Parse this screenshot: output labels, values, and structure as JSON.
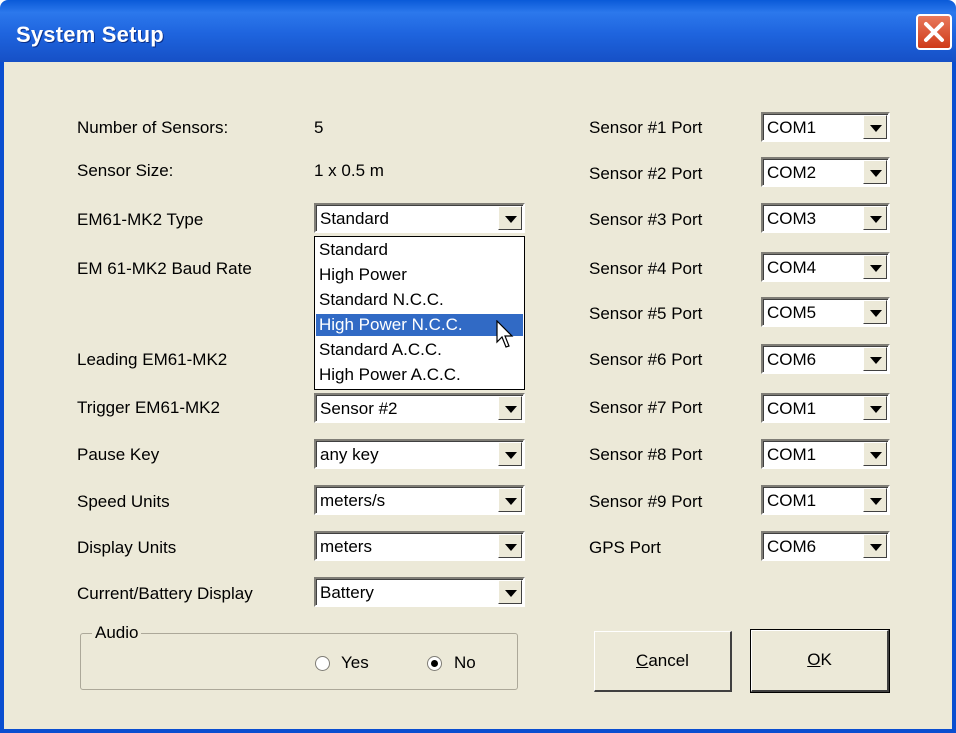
{
  "window": {
    "title": "System Setup"
  },
  "left_fields": {
    "num_sensors_label": "Number of Sensors:",
    "num_sensors_value": "5",
    "sensor_size_label": "Sensor Size:",
    "sensor_size_value": "1 x 0.5 m",
    "em_type_label": "EM61-MK2 Type",
    "em_type_value": "Standard",
    "baud_label": "EM 61-MK2 Baud Rate",
    "leading_label": "Leading EM61-MK2",
    "trigger_label": "Trigger EM61-MK2",
    "trigger_value": "Sensor #2",
    "pause_label": "Pause Key",
    "pause_value": "any key",
    "speed_label": "Speed Units",
    "speed_value": "meters/s",
    "display_label": "Display Units",
    "display_value": "meters",
    "current_label": "Current/Battery Display",
    "current_value": "Battery"
  },
  "type_dropdown": {
    "options": [
      "Standard",
      "High Power",
      "Standard   N.C.C.",
      "High Power N.C.C.",
      "Standard   A.C.C.",
      "High Power A.C.C."
    ],
    "highlighted": "High Power N.C.C."
  },
  "ports": [
    {
      "label": "Sensor #1  Port",
      "value": "COM1"
    },
    {
      "label": "Sensor #2  Port",
      "value": "COM2"
    },
    {
      "label": "Sensor #3  Port",
      "value": "COM3"
    },
    {
      "label": "Sensor #4  Port",
      "value": "COM4"
    },
    {
      "label": "Sensor #5  Port",
      "value": "COM5"
    },
    {
      "label": "Sensor #6  Port",
      "value": "COM6"
    },
    {
      "label": "Sensor #7  Port",
      "value": "COM1"
    },
    {
      "label": "Sensor #8  Port",
      "value": "COM1"
    },
    {
      "label": "Sensor #9  Port",
      "value": "COM1"
    },
    {
      "label": "GPS Port",
      "value": "COM6"
    }
  ],
  "audio": {
    "group_label": "Audio",
    "yes_label": "Yes",
    "no_label": "No",
    "selected": "No"
  },
  "buttons": {
    "cancel_first": "C",
    "cancel_rest": "ancel",
    "ok_first": "O",
    "ok_rest": "K"
  },
  "icons": {
    "close": "close-x-icon",
    "dropdown_arrow": "chevron-down-icon",
    "cursor": "mouse-pointer-icon"
  },
  "colors": {
    "titlebar": "#1e64de",
    "close_button": "#d8502c",
    "dialog_bg": "#ece9d8",
    "selection": "#316ac5"
  }
}
